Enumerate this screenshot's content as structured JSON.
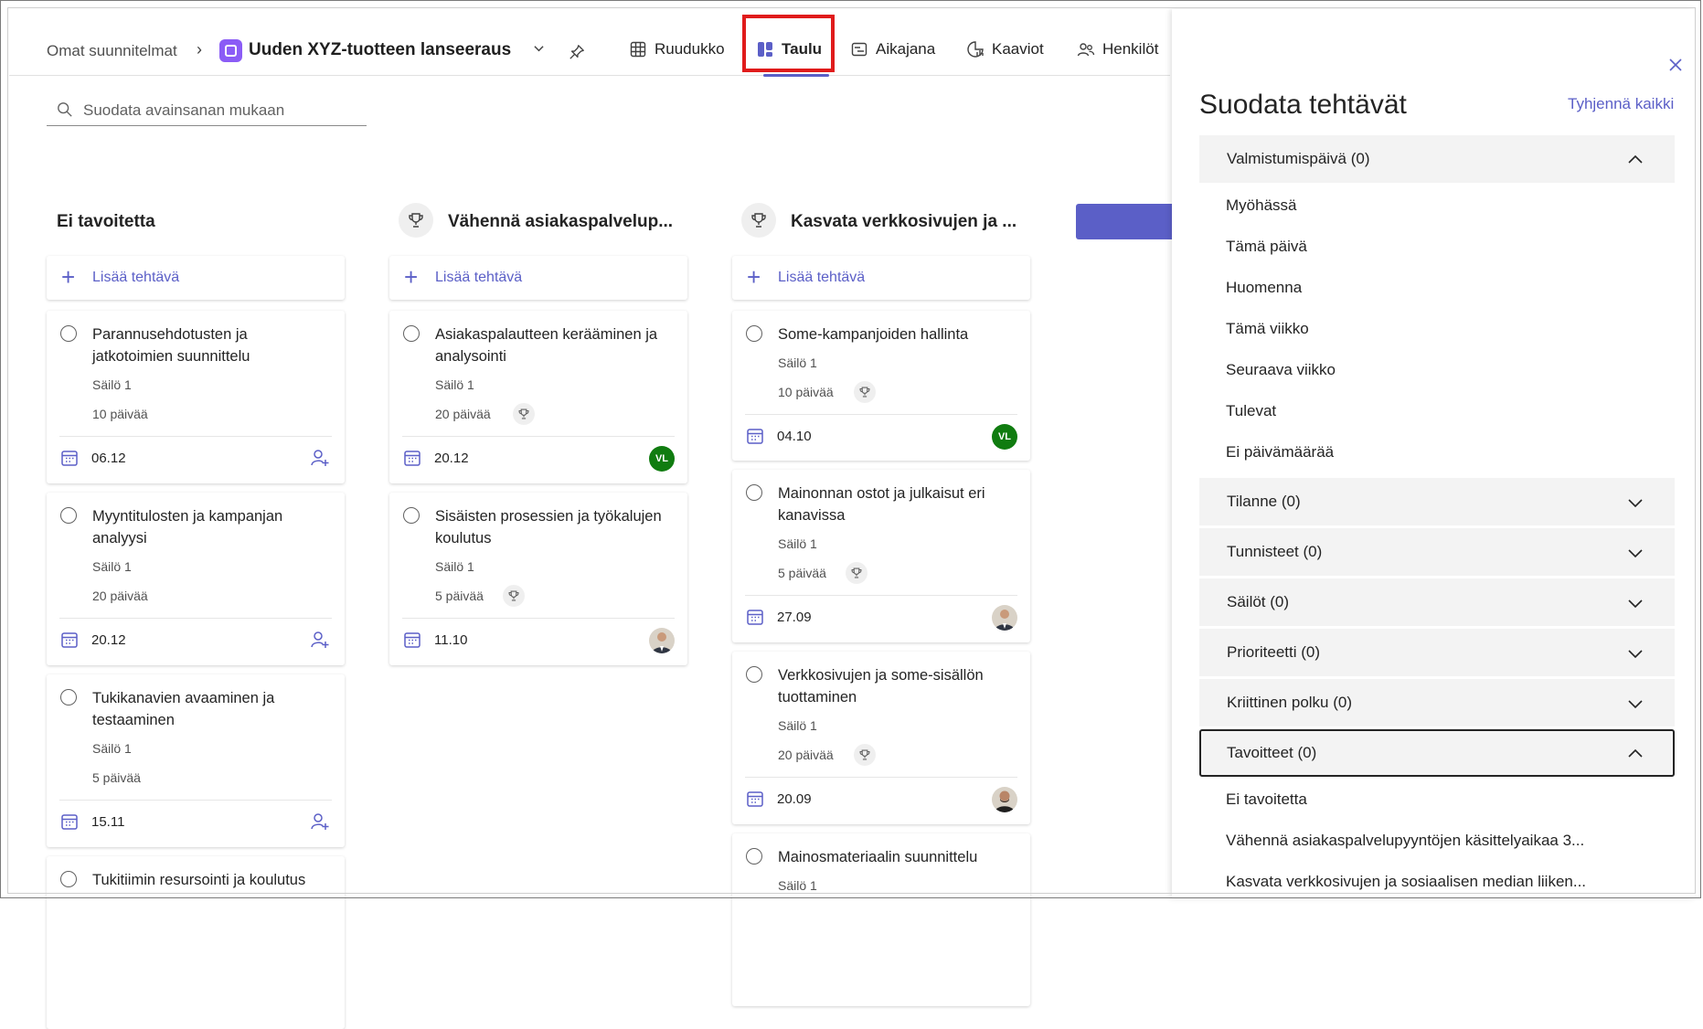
{
  "header": {
    "breadcrumb": "Omat suunnitelmat",
    "plan_title": "Uuden XYZ-tuotteen lanseeraus",
    "tabs": [
      {
        "label": "Ruudukko",
        "icon": "grid-icon"
      },
      {
        "label": "Taulu",
        "icon": "board-icon",
        "active": true
      },
      {
        "label": "Aikajana",
        "icon": "timeline-icon"
      },
      {
        "label": "Kaaviot",
        "icon": "charts-icon"
      },
      {
        "label": "Henkilöt",
        "icon": "people-icon"
      }
    ]
  },
  "search": {
    "placeholder": "Suodata avainsanan mukaan"
  },
  "board": {
    "add_task_label": "Lisää tehtävä",
    "columns": [
      {
        "title": "Ei tavoitetta",
        "cards": [
          {
            "title": "Parannusehdotusten ja jatkotoimien suunnittelu",
            "bucket": "Säilö 1",
            "duration": "10 päivää",
            "date": "06.12"
          },
          {
            "title": "Myyntitulosten ja kampanjan analyysi",
            "bucket": "Säilö 1",
            "duration": "20 päivää",
            "date": "20.12"
          },
          {
            "title": "Tukikanavien avaaminen ja testaaminen",
            "bucket": "Säilö 1",
            "duration": "5 päivää",
            "date": "15.11"
          },
          {
            "title": "Tukitiimin resursointi ja koulutus"
          }
        ]
      },
      {
        "title": "Vähennä asiakaspalvelup...",
        "cards": [
          {
            "title": "Asiakaspalautteen kerääminen ja analysointi",
            "bucket": "Säilö 1",
            "duration": "20 päivää",
            "date": "20.12",
            "avatar": "VL"
          },
          {
            "title": "Sisäisten prosessien ja työkalujen koulutus",
            "bucket": "Säilö 1",
            "duration": "5 päivää",
            "date": "11.10"
          }
        ]
      },
      {
        "title": "Kasvata verkkosivujen ja ...",
        "cards": [
          {
            "title": "Some-kampanjoiden hallinta",
            "bucket": "Säilö 1",
            "duration": "10 päivää",
            "date": "04.10",
            "avatar": "VL"
          },
          {
            "title": "Mainonnan ostot ja julkaisut eri kanavissa",
            "bucket": "Säilö 1",
            "duration": "5 päivää",
            "date": "27.09"
          },
          {
            "title": "Verkkosivujen ja some-sisällön tuottaminen",
            "bucket": "Säilö 1",
            "duration": "20 päivää",
            "date": "20.09"
          },
          {
            "title": "Mainosmateriaalin suunnittelu",
            "bucket": "Säilö 1"
          }
        ]
      }
    ]
  },
  "filter_panel": {
    "title": "Suodata tehtävät",
    "clear_all": "Tyhjennä kaikki",
    "due_date": {
      "label": "Valmistumispäivä (0)",
      "options": [
        "Myöhässä",
        "Tämä päivä",
        "Huomenna",
        "Tämä viikko",
        "Seuraava viikko",
        "Tulevat",
        "Ei päivämäärää"
      ]
    },
    "sections": [
      "Tilanne (0)",
      "Tunnisteet (0)",
      "Säilöt (0)",
      "Prioriteetti (0)",
      "Kriittinen polku (0)"
    ],
    "goals": {
      "label": "Tavoitteet (0)",
      "options": [
        "Ei tavoitetta",
        "Vähennä asiakaspalvelupyyntöjen käsittelyaikaa 3...",
        "Kasvata verkkosivujen ja sosiaalisen median liiken..."
      ]
    }
  },
  "colors": {
    "accent": "#5b5fc7",
    "highlight": "#e01b1b",
    "avatar_green": "#107c10"
  }
}
